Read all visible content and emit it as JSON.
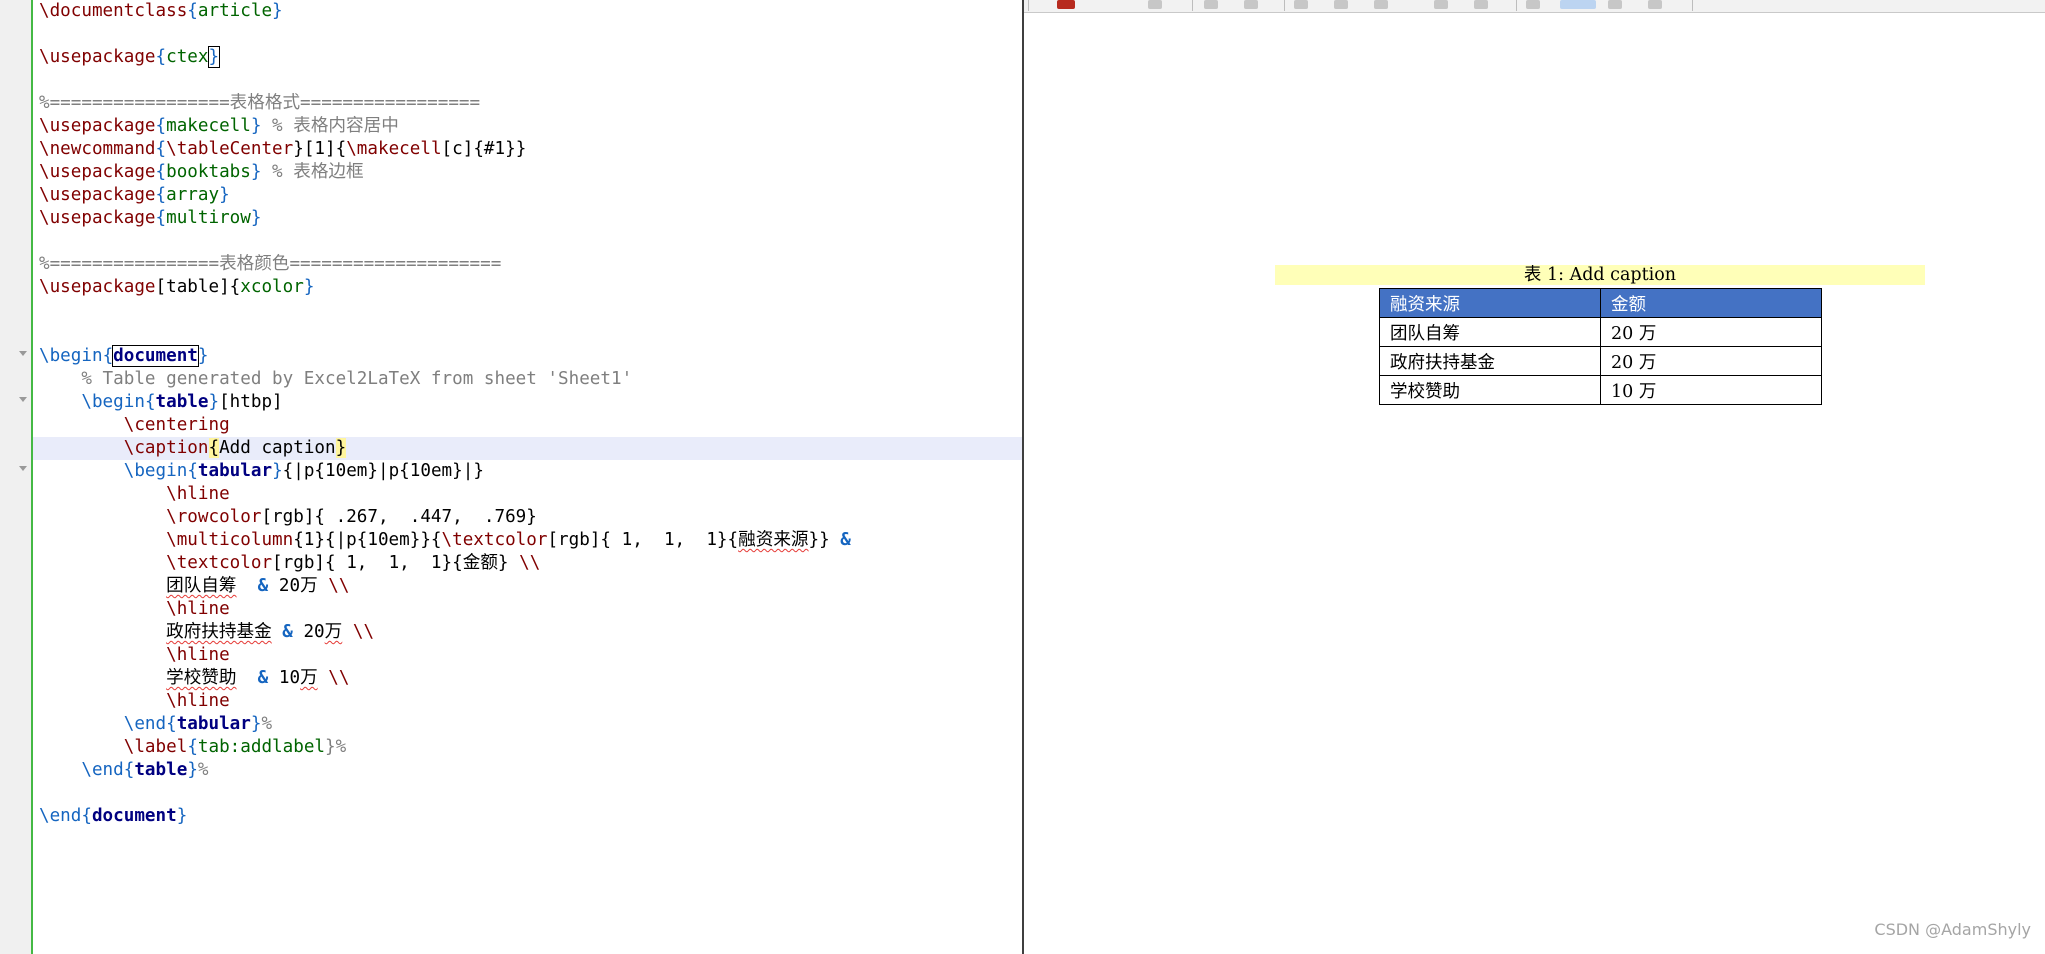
{
  "editor": {
    "lines": {
      "l1": {
        "a": "\\documentclass",
        "b": "{",
        "c": "article",
        "d": "}"
      },
      "l3": {
        "a": "\\usepackage",
        "b": "{",
        "c": "ctex",
        "d": "}"
      },
      "l5": {
        "t": "%=================表格格式================="
      },
      "l6": {
        "a": "\\usepackage",
        "b": "{",
        "c": "makecell",
        "d": "}",
        "e": " % 表格内容居中"
      },
      "l7": {
        "a": "\\newcommand",
        "b": "{",
        "c": "\\tableCenter",
        "d": "}[1]{",
        "e": "\\makecell",
        "f": "[c]{#1}}"
      },
      "l8": {
        "a": "\\usepackage",
        "b": "{",
        "c": "booktabs",
        "d": "}",
        "e": " % 表格边框"
      },
      "l9": {
        "a": "\\usepackage",
        "b": "{",
        "c": "array",
        "d": "}"
      },
      "l10": {
        "a": "\\usepackage",
        "b": "{",
        "c": "multirow",
        "d": "}"
      },
      "l12": {
        "t": "%================表格颜色===================="
      },
      "l13": {
        "a": "\\usepackage",
        "b": "[table]{",
        "c": "xcolor",
        "d": "}"
      },
      "l16": {
        "a": "\\begin",
        "b": "{",
        "c": "document",
        "d": "}"
      },
      "l17": {
        "t": "    % Table generated by Excel2LaTeX from sheet 'Sheet1'"
      },
      "l18": {
        "a": "\\begin",
        "b": "{",
        "c": "table",
        "d": "}",
        "e": "[htbp]"
      },
      "l19": {
        "a": "\\centering"
      },
      "l20": {
        "a": "\\caption",
        "b": "{",
        "c": "Add caption",
        "d": "}"
      },
      "l21": {
        "a": "\\begin",
        "b": "{",
        "c": "tabular",
        "d": "}",
        "e": "{|p{10em}|p{10em}|}"
      },
      "l22": {
        "a": "\\hline"
      },
      "l23": {
        "a": "\\rowcolor",
        "b": "[rgb]{ .267,  .447,  .769}"
      },
      "l24": {
        "a": "\\multicolumn",
        "b": "{1}{|p{10em}}{",
        "c": "\\textcolor",
        "d": "[rgb]{ 1,  1,  1}{",
        "e": "融资来源",
        "f": "}}",
        "g": " &"
      },
      "l25": {
        "a": "\\textcolor",
        "b": "[rgb]{ 1,  1,  1}{",
        "c": "金额",
        "d": "} ",
        "e": "\\\\"
      },
      "l26": {
        "a": "团队自筹",
        "b": "  & ",
        "c": "20",
        "d": "万",
        "e": " \\\\"
      },
      "l27": {
        "a": "\\hline"
      },
      "l28": {
        "a": "政府扶持基金",
        "b": " & ",
        "c": "20",
        "d": "万",
        "e": " \\\\"
      },
      "l29": {
        "a": "\\hline"
      },
      "l30": {
        "a": "学校赞助",
        "b": "  & ",
        "c": "10",
        "d": "万",
        "e": " \\\\"
      },
      "l31": {
        "a": "\\hline"
      },
      "l32": {
        "a": "\\end",
        "b": "{",
        "c": "tabular",
        "d": "}",
        "e": "%"
      },
      "l33": {
        "a": "\\label",
        "b": "{",
        "c": "tab:addlabel",
        "d": "}%"
      },
      "l34": {
        "a": "\\end",
        "b": "{",
        "c": "table",
        "d": "}",
        "e": "%"
      },
      "l36": {
        "a": "\\end",
        "b": "{",
        "c": "document",
        "d": "}"
      }
    }
  },
  "preview": {
    "caption": "表 1: Add caption",
    "table": {
      "header": [
        "融资来源",
        "金额"
      ],
      "rows": [
        [
          "团队自筹",
          "20 万"
        ],
        [
          "政府扶持基金",
          "20 万"
        ],
        [
          "学校赞助",
          "10 万"
        ]
      ],
      "header_color": "#4472c4"
    }
  },
  "watermark": "CSDN @AdamShyly"
}
